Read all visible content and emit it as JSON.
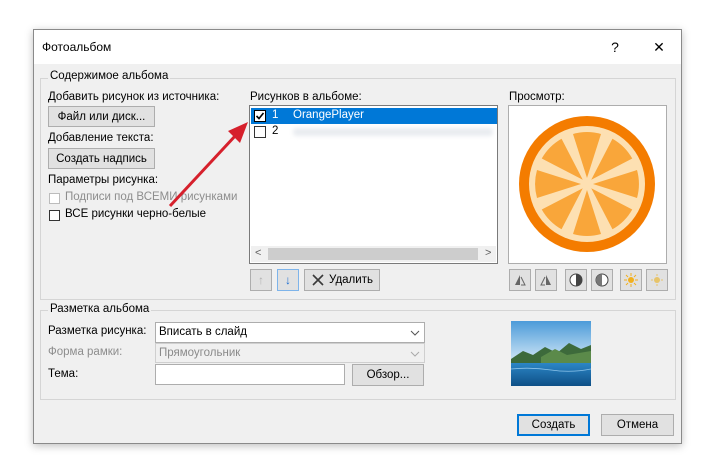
{
  "dialog": {
    "title": "Фотоальбом",
    "help_label": "?",
    "close_label": "✕"
  },
  "contents_group": {
    "legend": "Содержимое альбома",
    "add_picture_from": "Добавить рисунок из источника:",
    "file_disk_button": "Файл или диск...",
    "add_text": "Добавление текста:",
    "create_caption_button": "Создать надпись",
    "picture_options": "Параметры рисунка:",
    "captions_below_all": "Подписи под ВСЕМИ рисунками",
    "all_black_white": "ВСЕ рисунки черно-белые",
    "pictures_in_album_label": "Рисунков в альбоме:",
    "pictures": [
      {
        "number": "1",
        "name": "OrangePlayer",
        "checked": true,
        "selected": true
      },
      {
        "number": "2",
        "name": "",
        "checked": false,
        "selected": false
      }
    ],
    "up_arrow": "↑",
    "down_arrow": "↓",
    "remove_button": "Удалить",
    "preview_label": "Просмотр:"
  },
  "layout_group": {
    "legend": "Разметка альбома",
    "picture_layout_label": "Разметка рисунка:",
    "picture_layout_value": "Вписать в слайд",
    "frame_shape_label": "Форма рамки:",
    "frame_shape_value": "Прямоугольник",
    "theme_label": "Тема:",
    "theme_value": "",
    "browse_button": "Обзор..."
  },
  "footer": {
    "create_button": "Создать",
    "cancel_button": "Отмена"
  },
  "colors": {
    "accent": "#0078d7",
    "orange_rim": "#f47c00",
    "orange_segment": "#f9a63a",
    "annotation_arrow": "#d6202c"
  }
}
